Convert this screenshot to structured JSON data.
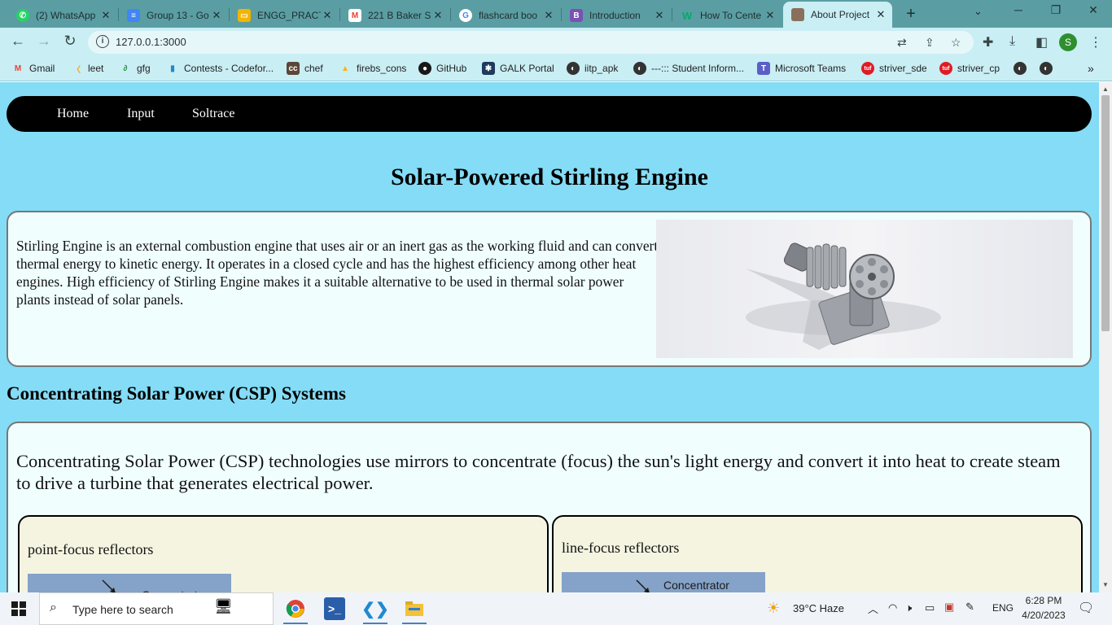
{
  "browser": {
    "tabs": [
      {
        "title": "(2) WhatsApp",
        "icon": "whatsapp-icon",
        "color": "#25d366",
        "active": false
      },
      {
        "title": "Group 13 - Go",
        "icon": "google-docs-icon",
        "color": "#4285f4",
        "active": false
      },
      {
        "title": "ENGG_PRACT",
        "icon": "google-slides-icon",
        "color": "#f4b400",
        "active": false
      },
      {
        "title": "221 B Baker S",
        "icon": "gmail-icon",
        "color": "#ea4335",
        "active": false
      },
      {
        "title": "flashcard boo",
        "icon": "google-icon",
        "color": "#ffffff",
        "active": false
      },
      {
        "title": "Introduction",
        "icon": "bootstrap-icon",
        "color": "#7952b3",
        "active": false
      },
      {
        "title": "How To Cente",
        "icon": "w3schools-icon",
        "color": "#04aa6d",
        "active": false
      },
      {
        "title": "About Project",
        "icon": "page-favicon-icon",
        "color": "#8a6f5a",
        "active": true
      }
    ],
    "url": "127.0.0.1:3000",
    "profile_initial": "S",
    "bookmarks": [
      {
        "label": "Gmail",
        "icon": "gmail-icon",
        "color": "#ea4335"
      },
      {
        "label": "leet",
        "icon": "leetcode-icon",
        "color": "#f89f1b"
      },
      {
        "label": "gfg",
        "icon": "gfg-icon",
        "color": "#2f8d46"
      },
      {
        "label": "Contests - Codefor...",
        "icon": "codeforces-icon",
        "color": "#1f8acb"
      },
      {
        "label": "chef",
        "icon": "codechef-icon",
        "color": "#5b4638"
      },
      {
        "label": "firebs_cons",
        "icon": "firebase-icon",
        "color": "#ffca28"
      },
      {
        "label": "GitHub",
        "icon": "github-icon",
        "color": "#181717"
      },
      {
        "label": "GALK Portal",
        "icon": "portal-icon",
        "color": "#1e3a5f"
      },
      {
        "label": "iitp_apk",
        "icon": "globe-icon",
        "color": "#333333"
      },
      {
        "label": "---::: Student Inform...",
        "icon": "globe-icon",
        "color": "#333333"
      },
      {
        "label": "Microsoft Teams",
        "icon": "teams-icon",
        "color": "#5b5fc7"
      },
      {
        "label": "striver_sde",
        "icon": "tuf-icon",
        "color": "#e01b24"
      },
      {
        "label": "striver_cp",
        "icon": "tuf-icon",
        "color": "#e01b24"
      }
    ]
  },
  "page": {
    "nav": [
      "Home",
      "Input",
      "Soltrace"
    ],
    "title": "Solar-Powered Stirling Engine",
    "intro": "Stirling Engine is an external combustion engine that uses air or an inert gas as the working fluid and can convert thermal energy to kinetic energy. It operates in a closed cycle and has the highest efficiency among other heat engines. High efficiency of Stirling Engine makes it a suitable alternative to be used in thermal solar power plants instead of solar panels.",
    "csp_heading": "Concentrating Solar Power (CSP) Systems",
    "csp_text": "Concentrating Solar Power (CSP) technologies use mirrors to concentrate (focus) the sun's light energy and convert it into heat to create steam to drive a turbine that generates electrical power.",
    "point_focus_label": "point-focus reflectors",
    "line_focus_label": "line-focus reflectors",
    "diagram_label": "Concentrator"
  },
  "taskbar": {
    "search_placeholder": "Type here to search",
    "weather": "39°C  Haze",
    "language": "ENG",
    "time": "6:28 PM",
    "date": "4/20/2023"
  },
  "colors": {
    "page_bg": "#84dcf6",
    "card_bg": "#f0fefe",
    "subcard_bg": "#f4f4e1",
    "navbar_bg": "#000000"
  }
}
